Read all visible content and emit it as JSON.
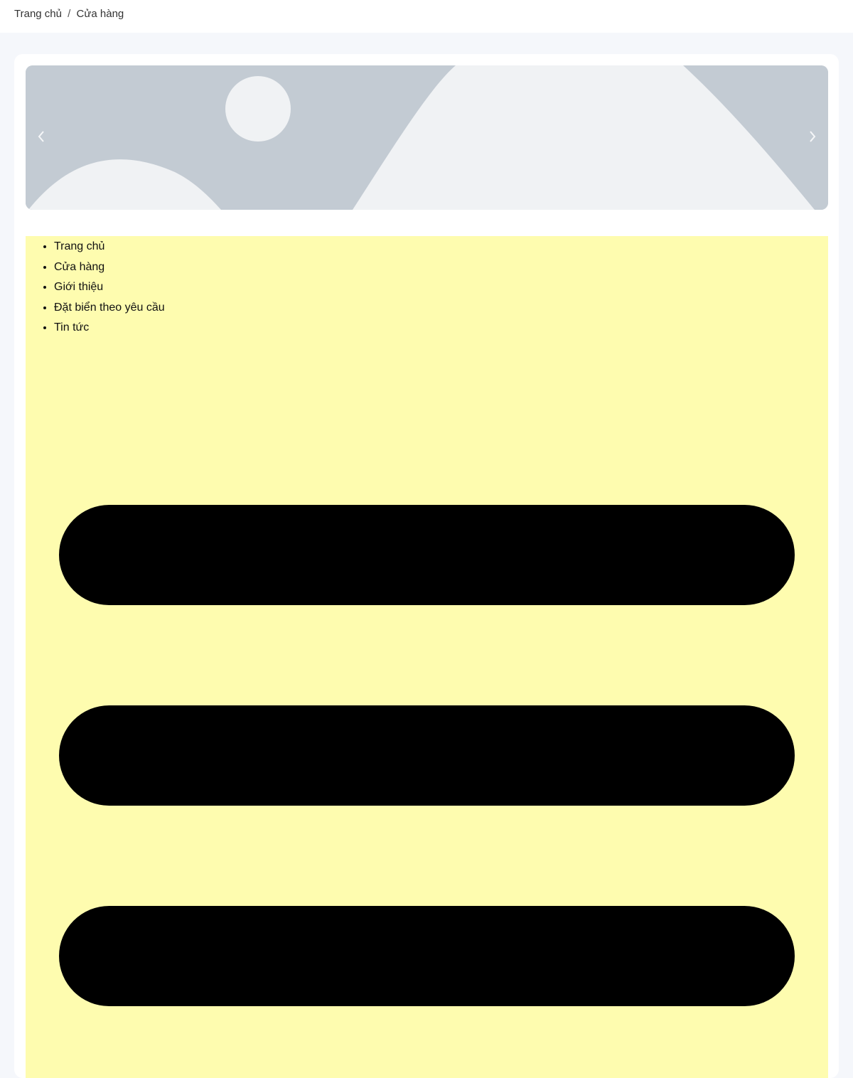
{
  "breadcrumb": {
    "items": [
      "Trang chủ",
      "Cửa hàng"
    ],
    "separator": "/"
  },
  "carousel": {
    "image": "image-placeholder-icon",
    "prev_icon": "chevron-left-icon",
    "next_icon": "chevron-right-icon"
  },
  "menu": {
    "items": [
      {
        "label": "Trang chủ"
      },
      {
        "label": "Cửa hàng"
      },
      {
        "label": "Giới thiệu"
      },
      {
        "label": "Đặt biển theo yêu cầu"
      },
      {
        "label": "Tin tức"
      }
    ],
    "toggle_icon": "hamburger-menu-icon"
  },
  "colors": {
    "page_bg": "#f5f7fb",
    "menu_panel_bg": "#fefcaf",
    "placeholder_dark": "#c3cbd3",
    "placeholder_light": "#f0f2f4",
    "hamburger": "#000000"
  }
}
